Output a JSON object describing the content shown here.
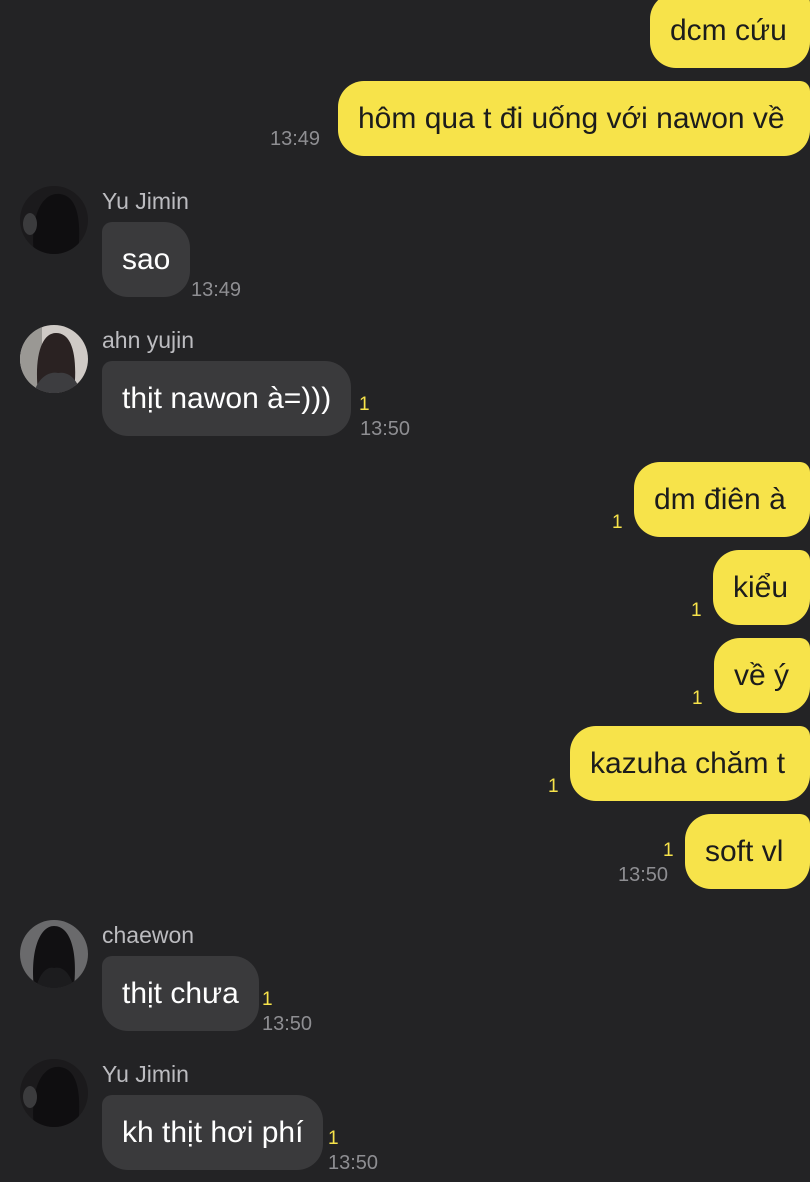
{
  "colors": {
    "background": "#232325",
    "outgoing_bubble": "#f7e34a",
    "incoming_bubble": "#3a3a3c",
    "unread": "#f7e34a",
    "time": "#8e8e92"
  },
  "messages": [
    {
      "text": "dcm cứu"
    },
    {
      "text": "hôm qua t đi uống với nawon về",
      "time": "13:49"
    },
    {
      "sender": "Yu Jimin",
      "text": "sao",
      "time": "13:49"
    },
    {
      "sender": "ahn yujin",
      "text": "thịt nawon à=)))",
      "unread": "1",
      "time": "13:50"
    },
    {
      "text": "dm điên à",
      "unread": "1"
    },
    {
      "text": "kiểu",
      "unread": "1"
    },
    {
      "text": "về ý",
      "unread": "1"
    },
    {
      "text": "kazuha chăm t",
      "unread": "1"
    },
    {
      "text": "soft vl",
      "unread": "1",
      "time": "13:50"
    },
    {
      "sender": "chaewon",
      "text": "thịt chưa",
      "unread": "1",
      "time": "13:50"
    },
    {
      "sender": "Yu Jimin",
      "text": "kh thịt hơi phí",
      "unread": "1",
      "time": "13:50"
    }
  ]
}
